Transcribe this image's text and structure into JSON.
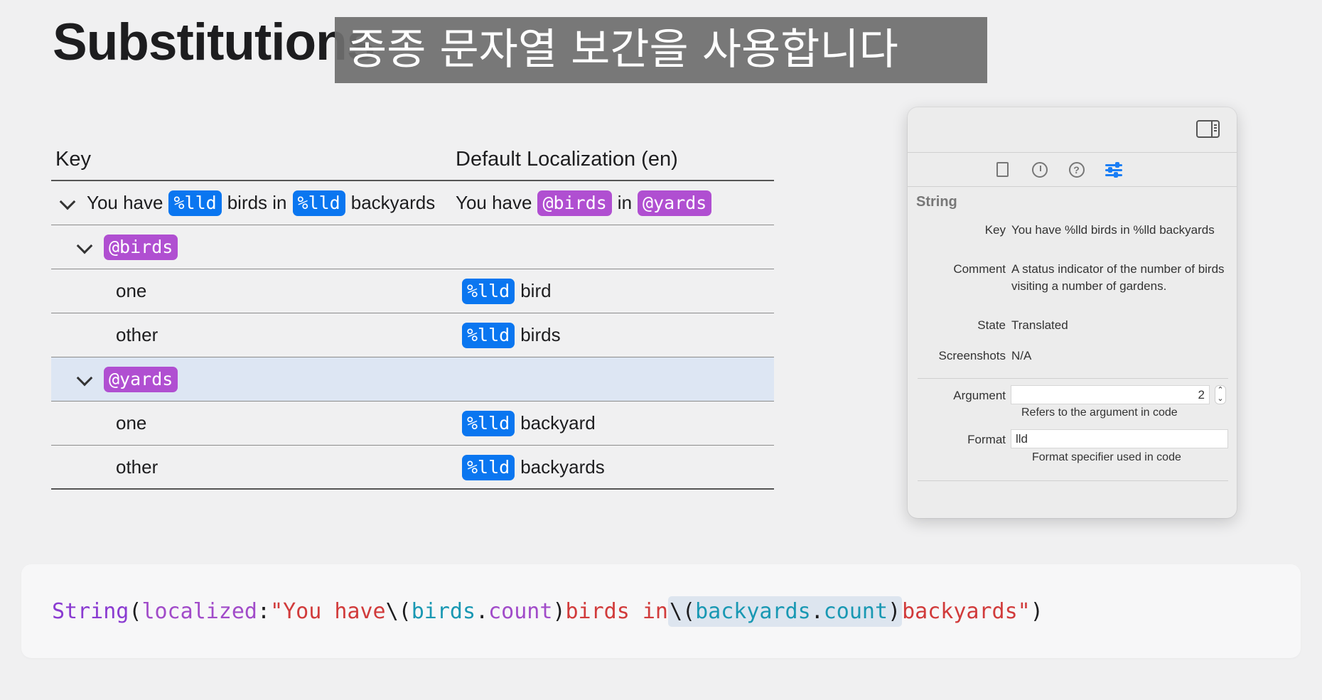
{
  "slide": {
    "title": "Substitutions",
    "caption": "종종 문자열 보간을 사용합니다"
  },
  "table": {
    "headers": {
      "key": "Key",
      "localization": "Default Localization (en)"
    },
    "main_row": {
      "key_parts": [
        "You have",
        "%lld",
        "birds in",
        "%lld",
        "backyards"
      ],
      "value_parts": [
        "You have",
        "@birds",
        "in",
        "@yards"
      ]
    },
    "groups": [
      {
        "name": "@birds",
        "rows": [
          {
            "key": "one",
            "token": "%lld",
            "value": "bird"
          },
          {
            "key": "other",
            "token": "%lld",
            "value": "birds"
          }
        ]
      },
      {
        "name": "@yards",
        "rows": [
          {
            "key": "one",
            "token": "%lld",
            "value": "backyard"
          },
          {
            "key": "other",
            "token": "%lld",
            "value": "backyards"
          }
        ]
      }
    ]
  },
  "inspector": {
    "section": "String",
    "key_label": "Key",
    "key_value": "You have %lld birds in %lld backyards",
    "comment_label": "Comment",
    "comment_value": "A status indicator of the number of birds visiting a number of gardens.",
    "state_label": "State",
    "state_value": "Translated",
    "screenshots_label": "Screenshots",
    "screenshots_value": "N/A",
    "argument_label": "Argument",
    "argument_value": "2",
    "argument_hint": "Refers to the argument in code",
    "format_label": "Format",
    "format_value": "lld",
    "format_hint": "Format specifier used in code",
    "stepper_up": "⌃",
    "stepper_down": "⌄",
    "help_glyph": "?",
    "icons": [
      "file-icon",
      "history-icon",
      "help-icon",
      "attributes-icon",
      "sidebar-toggle-icon"
    ]
  },
  "code": {
    "type": "String",
    "open_paren": "(",
    "param": "localized",
    "colon": ": ",
    "str1": "\"You have ",
    "interp_open1": "\\(",
    "var1": "birds",
    "dot1": ".",
    "prop1": "count",
    "interp_close1": ")",
    "str2": " birds in ",
    "interp_open2": "\\(",
    "var2": "backyards",
    "dot2": ".",
    "prop2": "count",
    "interp_close2": ")",
    "str3": " backyards\"",
    "close_paren": ")"
  },
  "colors": {
    "token_blue": "#0a76f0",
    "token_purple": "#b04fd1",
    "selection": "#dde6f3",
    "accent": "#1a7ef5"
  }
}
